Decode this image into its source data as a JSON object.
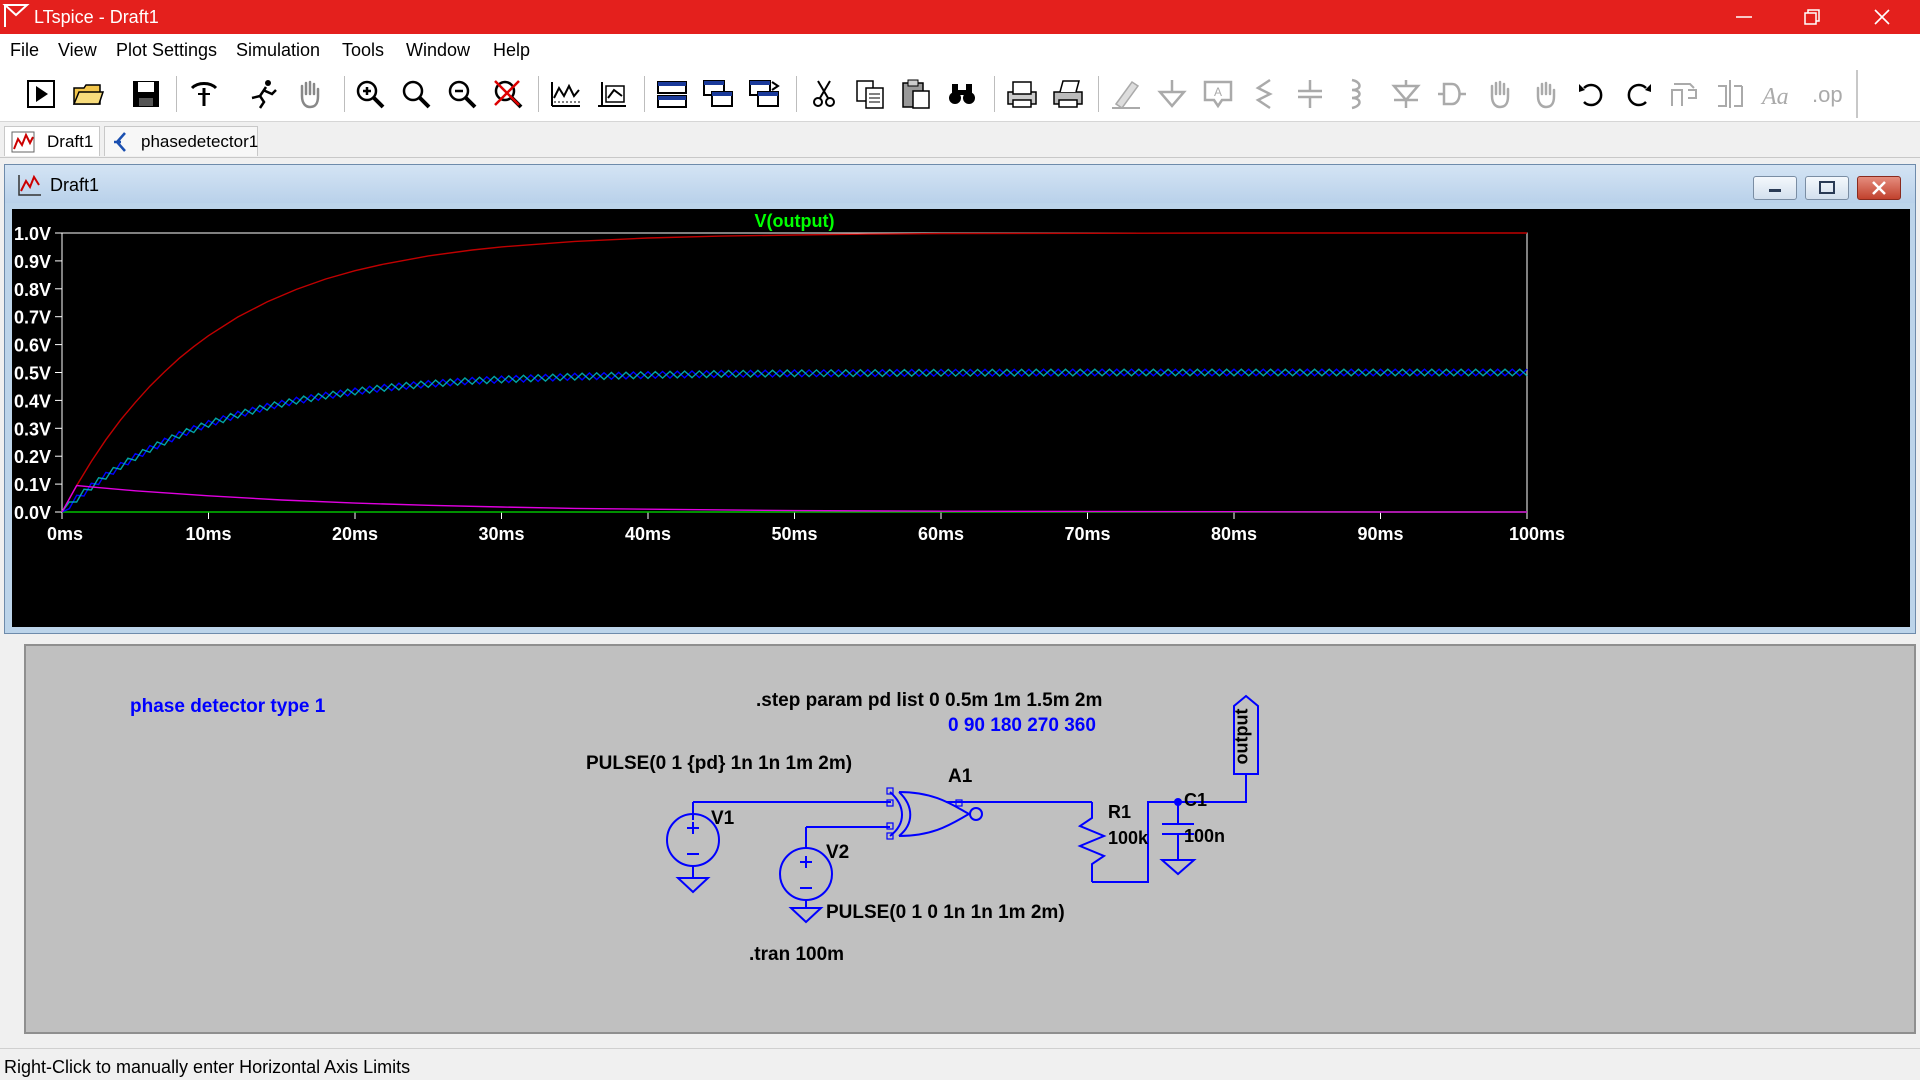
{
  "window": {
    "title": "LTspice - Draft1",
    "icon": "ltspice-logo-icon"
  },
  "menu": {
    "items": [
      {
        "label": "File"
      },
      {
        "label": "View"
      },
      {
        "label": "Plot Settings"
      },
      {
        "label": "Simulation"
      },
      {
        "label": "Tools"
      },
      {
        "label": "Window"
      },
      {
        "label": "Help"
      }
    ]
  },
  "toolbar": {
    "buttons": [
      "run-icon",
      "open-folder-icon",
      "save-icon",
      "control-panel-icon",
      "run-halt-icon",
      "pan-hand-icon",
      "zoom-in-icon",
      "zoom-area-icon",
      "zoom-out-icon",
      "zoom-cancel-icon",
      "autorange-icon",
      "manual-limits-icon",
      "tile-horizontal-icon",
      "cascade-icon",
      "tile-vertical-icon",
      "cut-icon",
      "copy-icon",
      "paste-icon",
      "find-icon",
      "print-preview-icon",
      "print-icon",
      "wire-icon",
      "ground-icon",
      "label-net-icon",
      "resistor-icon",
      "capacitor-icon",
      "inductor-icon",
      "diode-icon",
      "component-icon",
      "move-icon",
      "drag-icon",
      "undo-icon",
      "redo-icon",
      "rotate-icon",
      "mirror-icon",
      "text-icon",
      "spice-directive-icon"
    ]
  },
  "tabs": [
    {
      "label": "Draft1",
      "icon": "waveform-icon"
    },
    {
      "label": "phasedetector1",
      "icon": "schematic-icon"
    }
  ],
  "plot_window": {
    "title": "Draft1",
    "icon": "waveform-icon"
  },
  "chart_data": {
    "type": "line",
    "title": "V(output)",
    "title_color": "#00ff00",
    "xlabel": "",
    "ylabel": "",
    "xlim": [
      0,
      100
    ],
    "ylim": [
      0,
      1.0
    ],
    "x_unit": "ms",
    "y_unit": "V",
    "x_ticks": [
      "0ms",
      "10ms",
      "20ms",
      "30ms",
      "40ms",
      "50ms",
      "60ms",
      "70ms",
      "80ms",
      "90ms",
      "100ms"
    ],
    "y_ticks": [
      "0.0V",
      "0.1V",
      "0.2V",
      "0.3V",
      "0.4V",
      "0.5V",
      "0.6V",
      "0.7V",
      "0.8V",
      "0.9V",
      "1.0V"
    ],
    "grid": false,
    "background": "#000000",
    "series": [
      {
        "color": "#00c000",
        "x": [
          0,
          100
        ],
        "y": [
          0.0,
          0.0
        ]
      },
      {
        "color": "#c00000",
        "x": [
          0,
          1,
          2,
          3,
          4,
          5,
          6,
          7,
          8,
          9,
          10,
          12,
          14,
          16,
          18,
          20,
          22,
          25,
          28,
          30,
          35,
          40,
          45,
          50,
          55,
          60,
          70,
          80,
          90,
          100
        ],
        "y": [
          0,
          0.095,
          0.181,
          0.259,
          0.33,
          0.393,
          0.451,
          0.503,
          0.551,
          0.593,
          0.632,
          0.699,
          0.753,
          0.798,
          0.835,
          0.865,
          0.889,
          0.918,
          0.939,
          0.95,
          0.97,
          0.982,
          0.989,
          0.993,
          0.996,
          0.998,
          0.999,
          1.0,
          1.0,
          1.0
        ]
      },
      {
        "color": "#0000ff",
        "x": [
          0,
          1,
          2,
          3,
          4,
          5,
          6,
          7,
          8,
          9,
          10,
          12,
          14,
          16,
          18,
          20,
          22,
          25,
          28,
          30,
          35,
          40,
          45,
          50,
          60,
          70,
          80,
          90,
          100
        ],
        "y": [
          0,
          0.048,
          0.091,
          0.13,
          0.165,
          0.197,
          0.226,
          0.252,
          0.276,
          0.297,
          0.316,
          0.349,
          0.377,
          0.399,
          0.417,
          0.432,
          0.445,
          0.459,
          0.47,
          0.475,
          0.485,
          0.491,
          0.495,
          0.497,
          0.499,
          0.5,
          0.5,
          0.5,
          0.5
        ],
        "ripple": 0.012
      },
      {
        "color": "#00bfbf",
        "x": [
          0,
          1,
          2,
          3,
          4,
          5,
          6,
          7,
          8,
          9,
          10,
          12,
          14,
          16,
          18,
          20,
          22,
          25,
          28,
          30,
          35,
          40,
          45,
          50,
          60,
          70,
          80,
          90,
          100
        ],
        "y": [
          0,
          0.048,
          0.091,
          0.13,
          0.165,
          0.197,
          0.226,
          0.252,
          0.276,
          0.297,
          0.316,
          0.349,
          0.377,
          0.399,
          0.417,
          0.432,
          0.445,
          0.459,
          0.47,
          0.475,
          0.485,
          0.491,
          0.495,
          0.497,
          0.499,
          0.5,
          0.5,
          0.5,
          0.5
        ],
        "ripple": 0.012
      },
      {
        "color": "#e000e0",
        "x": [
          0,
          1,
          2,
          5,
          10,
          15,
          20,
          25,
          30,
          35,
          40,
          50,
          60,
          70,
          80,
          90,
          100
        ],
        "y": [
          0,
          0.095,
          0.09,
          0.076,
          0.058,
          0.043,
          0.032,
          0.024,
          0.018,
          0.013,
          0.01,
          0.005,
          0.003,
          0.002,
          0.001,
          0.0,
          0.0
        ]
      }
    ]
  },
  "schematic": {
    "comment": "phase detector type 1",
    "step_directive": ".step param pd list 0 0.5m 1m 1.5m 2m",
    "step_note": "0 90 180 270 360",
    "v1_value": "PULSE(0 1 {pd} 1n 1n 1m 2m)",
    "v1_name": "V1",
    "v2_name": "V2",
    "v2_value": "PULSE(0 1 0 1n 1n 1m 2m)",
    "gate_name": "A1",
    "r1_name": "R1",
    "r1_value": "100k",
    "c1_name": "C1",
    "c1_value": "100n",
    "net_label": "output",
    "tran_directive": ".tran 100m",
    "colors": {
      "wire": "#0000ff",
      "directive": "#000000",
      "comment": "#0000ff",
      "background": "#c0c0c0"
    }
  },
  "status": {
    "text": "Right-Click to manually enter Horizontal Axis Limits"
  }
}
